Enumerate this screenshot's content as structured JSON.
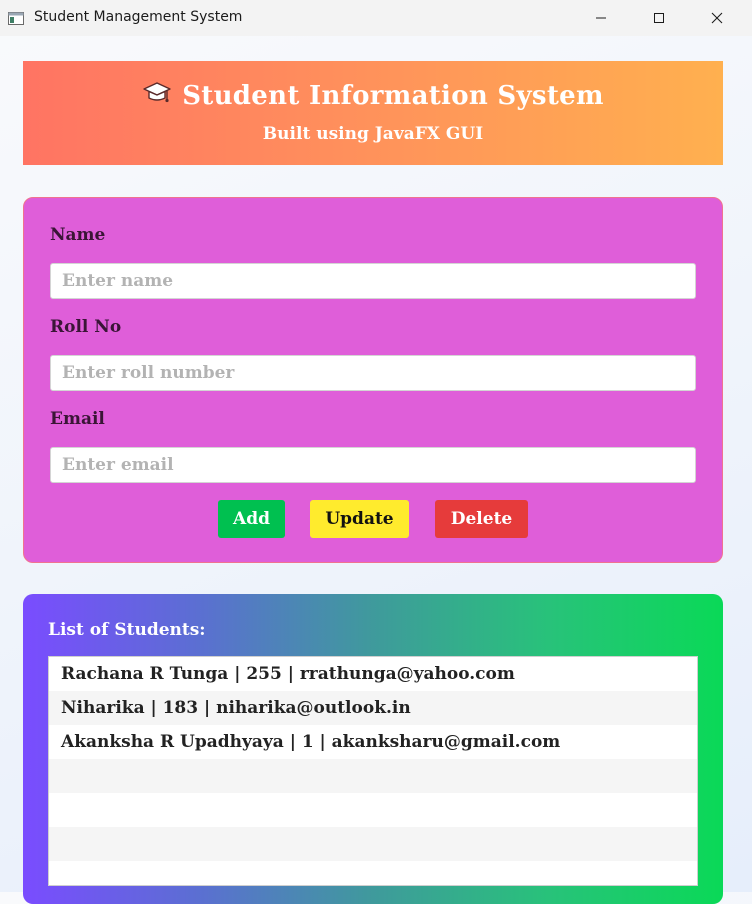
{
  "window": {
    "title": "Student Management System",
    "icon": "app-window-icon",
    "controls": [
      "minimize-icon",
      "maximize-icon",
      "close-icon"
    ]
  },
  "header": {
    "icon": "graduation-cap-icon",
    "title": "Student Information System",
    "subtitle": "Built using JavaFX GUI"
  },
  "form": {
    "name_label": "Name",
    "name_placeholder": "Enter name",
    "roll_label": "Roll No",
    "roll_placeholder": "Enter roll number",
    "email_label": "Email",
    "email_placeholder": "Enter email",
    "add_label": "Add",
    "update_label": "Update",
    "delete_label": "Delete"
  },
  "students": {
    "title": "List of Students:",
    "items": [
      "Rachana R Tunga | 255 | rrathunga@yahoo.com",
      "Niharika | 183 | niharika@outlook.in",
      "Akanksha R Upadhyaya | 1 | akanksharu@gmail.com",
      "",
      "",
      "",
      ""
    ]
  },
  "colors": {
    "banner_start": "#ff7463",
    "banner_end": "#ffb04f",
    "form_panel": "#df5ed9",
    "add": "#00c050",
    "update": "#ffeb2d",
    "delete": "#e63b3b",
    "list_start": "#7a4cff",
    "list_end": "#0ad957"
  }
}
